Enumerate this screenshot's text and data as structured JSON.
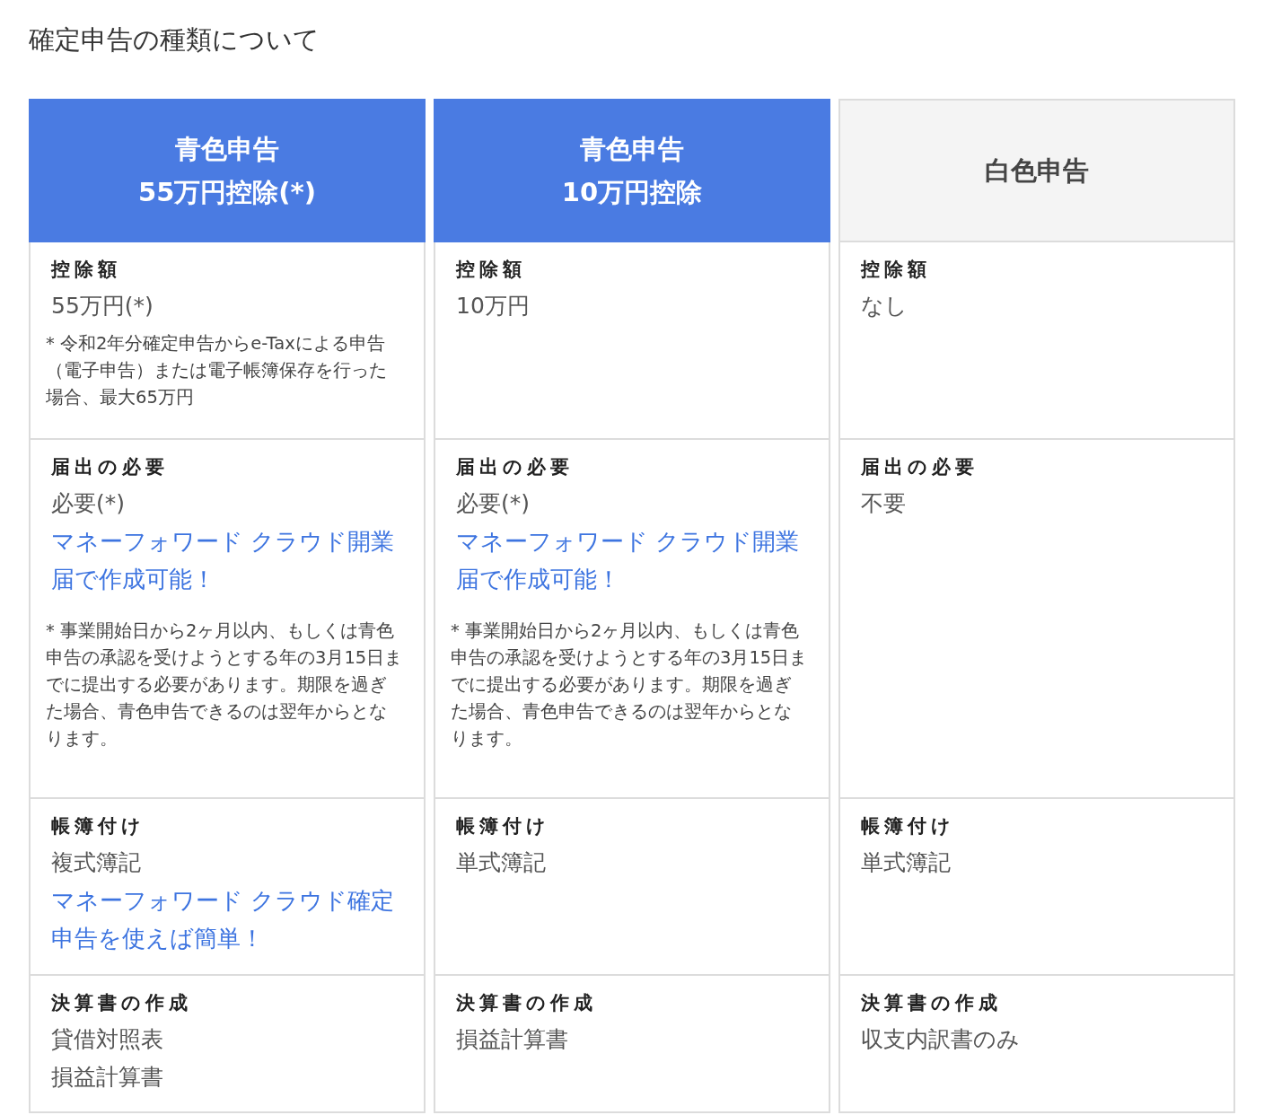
{
  "title": "確定申告の種類について",
  "headers": [
    {
      "kind": "blue",
      "lines": [
        "青色申告",
        "55万円控除(*)"
      ]
    },
    {
      "kind": "blue",
      "lines": [
        "青色申告",
        "10万円控除"
      ]
    },
    {
      "kind": "gray",
      "lines": [
        "白色申告"
      ]
    }
  ],
  "rows": [
    {
      "cells": [
        {
          "label": "控除額",
          "items": [
            {
              "kind": "value",
              "text": "55万円(*)"
            },
            {
              "kind": "note",
              "text": "* 令和2年分確定申告からe-Taxによる申告（電子申告）または電子帳簿保存を行った場合、最大65万円"
            }
          ]
        },
        {
          "label": "控除額",
          "items": [
            {
              "kind": "value",
              "text": "10万円"
            }
          ]
        },
        {
          "label": "控除額",
          "items": [
            {
              "kind": "value",
              "text": "なし"
            }
          ]
        }
      ]
    },
    {
      "cells": [
        {
          "label": "届出の必要",
          "items": [
            {
              "kind": "value",
              "text": "必要(*)"
            },
            {
              "kind": "link",
              "text": "マネーフォワード クラウド開業届で作成可能！"
            },
            {
              "kind": "note",
              "text": "* 事業開始日から2ヶ月以内、もしくは青色申告の承認を受けようとする年の3月15日までに提出する必要があります。期限を過ぎた場合、青色申告できるのは翌年からとなります。"
            }
          ]
        },
        {
          "label": "届出の必要",
          "items": [
            {
              "kind": "value",
              "text": "必要(*)"
            },
            {
              "kind": "link",
              "text": "マネーフォワード クラウド開業届で作成可能！"
            },
            {
              "kind": "note",
              "text": "* 事業開始日から2ヶ月以内、もしくは青色申告の承認を受けようとする年の3月15日までに提出する必要があります。期限を過ぎた場合、青色申告できるのは翌年からとなります。"
            }
          ]
        },
        {
          "label": "届出の必要",
          "items": [
            {
              "kind": "value",
              "text": "不要"
            }
          ]
        }
      ]
    },
    {
      "cells": [
        {
          "label": "帳簿付け",
          "items": [
            {
              "kind": "value",
              "text": "複式簿記"
            },
            {
              "kind": "link",
              "text": "マネーフォワード クラウド確定申告を使えば簡単！"
            }
          ]
        },
        {
          "label": "帳簿付け",
          "items": [
            {
              "kind": "value",
              "text": "単式簿記"
            }
          ]
        },
        {
          "label": "帳簿付け",
          "items": [
            {
              "kind": "value",
              "text": "単式簿記"
            }
          ]
        }
      ]
    },
    {
      "cells": [
        {
          "label": "決算書の作成",
          "items": [
            {
              "kind": "value",
              "text": "貸借対照表"
            },
            {
              "kind": "value",
              "text": "損益計算書"
            }
          ]
        },
        {
          "label": "決算書の作成",
          "items": [
            {
              "kind": "value",
              "text": "損益計算書"
            }
          ]
        },
        {
          "label": "決算書の作成",
          "items": [
            {
              "kind": "value",
              "text": "収支内訳書のみ"
            }
          ]
        }
      ]
    }
  ]
}
